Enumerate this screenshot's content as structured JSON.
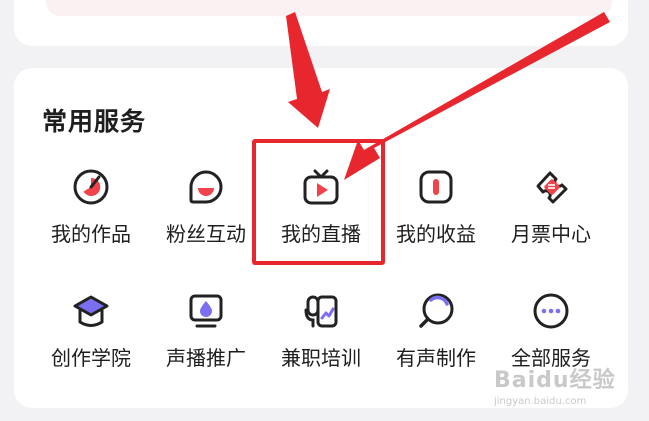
{
  "section": {
    "title": "常用服务"
  },
  "services": [
    {
      "label": "我的作品",
      "icon": "works-icon"
    },
    {
      "label": "粉丝互动",
      "icon": "fans-chat-icon"
    },
    {
      "label": "我的直播",
      "icon": "live-tv-icon"
    },
    {
      "label": "我的收益",
      "icon": "earnings-icon"
    },
    {
      "label": "月票中心",
      "icon": "monthly-ticket-icon"
    },
    {
      "label": "创作学院",
      "icon": "academy-cap-icon"
    },
    {
      "label": "声播推广",
      "icon": "promotion-icon"
    },
    {
      "label": "兼职培训",
      "icon": "training-icon"
    },
    {
      "label": "有声制作",
      "icon": "audio-production-icon"
    },
    {
      "label": "全部服务",
      "icon": "more-dots-icon"
    }
  ],
  "watermark": {
    "brand": "Baidu经验",
    "url": "jingyan.baidu.com"
  },
  "colors": {
    "accent": "#e8262e",
    "icon_stroke": "#222222",
    "icon_pink": "#f0434b",
    "icon_purple": "#7b6ff0"
  }
}
